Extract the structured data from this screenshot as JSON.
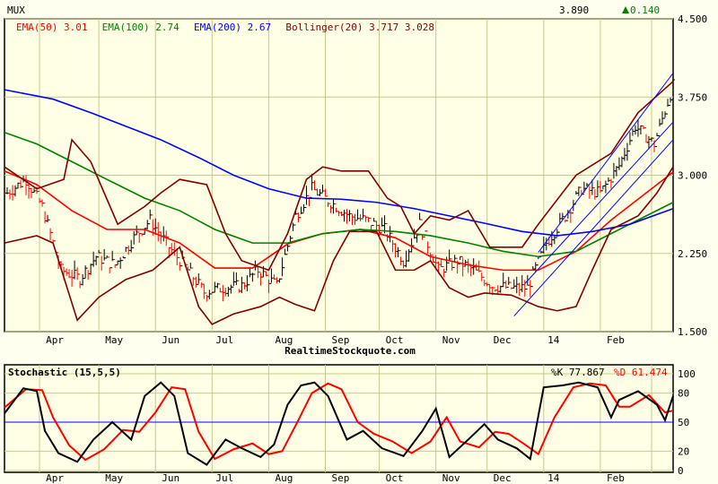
{
  "chart_data": [
    {
      "type": "line",
      "title": "MUX",
      "last_price": "3.890",
      "change": "0.140",
      "watermark": "RealtimeStockquote.com",
      "ylim": [
        1.5,
        4.5
      ],
      "yticks": [
        "4.500",
        "3.750",
        "3.000",
        "2.250",
        "1.500"
      ],
      "xlim": [
        0,
        248
      ],
      "xticks": [
        {
          "label": "Apr",
          "x": 16
        },
        {
          "label": "May",
          "x": 38
        },
        {
          "label": "Jun",
          "x": 59
        },
        {
          "label": "Jul",
          "x": 79
        },
        {
          "label": "Aug",
          "x": 101
        },
        {
          "label": "Sep",
          "x": 122
        },
        {
          "label": "Oct",
          "x": 142
        },
        {
          "label": "Nov",
          "x": 163
        },
        {
          "label": "Dec",
          "x": 182
        },
        {
          "label": "14",
          "x": 201
        },
        {
          "label": "Feb",
          "x": 224
        }
      ],
      "gridlines_x": [
        13,
        35,
        56,
        77,
        98,
        119,
        139,
        160,
        179,
        200,
        221,
        240
      ],
      "legend": [
        {
          "label": "EMA(50) 3.01",
          "color": "#ff0000"
        },
        {
          "label": "EMA(100) 2.74",
          "color": "#008000"
        },
        {
          "label": "EMA(200) 2.67",
          "color": "#0000ff"
        },
        {
          "label": "Bollinger(20) 3.717 3.028",
          "color": "#800000"
        }
      ],
      "price": {
        "x": [
          1,
          8,
          14,
          21,
          28,
          34,
          41,
          48,
          54,
          61,
          68,
          74,
          81,
          88,
          94,
          101,
          108,
          114,
          121,
          128,
          134,
          141,
          148,
          154,
          161,
          168,
          174,
          181,
          188,
          194,
          201,
          208,
          214,
          221,
          228,
          234,
          241,
          248
        ],
        "y": [
          2.83,
          2.96,
          2.7,
          2.09,
          2.01,
          2.22,
          2.14,
          2.4,
          2.57,
          2.31,
          2.09,
          1.88,
          1.92,
          1.94,
          2.09,
          1.94,
          2.61,
          2.87,
          2.74,
          2.61,
          2.57,
          2.48,
          2.18,
          2.53,
          2.09,
          2.18,
          2.09,
          1.94,
          1.92,
          1.92,
          2.35,
          2.61,
          2.87,
          2.83,
          3.09,
          3.47,
          3.3,
          3.86
        ]
      },
      "series": [
        {
          "name": "EMA(50)",
          "color": "#ff0000",
          "x": [
            0,
            12,
            25,
            38,
            52,
            65,
            78,
            92,
            105,
            118,
            132,
            145,
            158,
            172,
            185,
            198,
            212,
            225,
            238,
            248
          ],
          "y": [
            3.04,
            2.91,
            2.66,
            2.48,
            2.48,
            2.35,
            2.11,
            2.11,
            2.34,
            2.44,
            2.48,
            2.4,
            2.22,
            2.14,
            2.09,
            2.09,
            2.27,
            2.57,
            2.83,
            3.03
          ]
        },
        {
          "name": "EMA(100)",
          "color": "#008000",
          "x": [
            0,
            12,
            25,
            38,
            52,
            65,
            78,
            92,
            105,
            118,
            132,
            145,
            158,
            172,
            185,
            198,
            212,
            225,
            238,
            248
          ],
          "y": [
            3.41,
            3.3,
            3.13,
            2.96,
            2.78,
            2.66,
            2.48,
            2.35,
            2.35,
            2.44,
            2.48,
            2.46,
            2.42,
            2.35,
            2.27,
            2.22,
            2.27,
            2.44,
            2.61,
            2.74
          ]
        },
        {
          "name": "EMA(200)",
          "color": "#0000ff",
          "x": [
            0,
            18,
            32,
            45,
            58,
            72,
            85,
            98,
            112,
            125,
            138,
            152,
            165,
            178,
            192,
            205,
            218,
            232,
            248
          ],
          "y": [
            3.82,
            3.73,
            3.6,
            3.47,
            3.34,
            3.17,
            3.0,
            2.87,
            2.78,
            2.77,
            2.74,
            2.68,
            2.61,
            2.54,
            2.46,
            2.42,
            2.46,
            2.53,
            2.68
          ]
        },
        {
          "name": "Bollinger upper",
          "color": "#800000",
          "x": [
            0,
            12,
            22,
            25,
            32,
            42,
            52,
            58,
            65,
            75,
            82,
            88,
            98,
            105,
            112,
            118,
            125,
            135,
            142,
            147,
            152,
            158,
            165,
            172,
            180,
            192,
            198,
            212,
            225,
            235,
            248
          ],
          "y": [
            3.08,
            2.87,
            2.96,
            3.34,
            3.13,
            2.53,
            2.7,
            2.83,
            2.96,
            2.91,
            2.44,
            2.18,
            2.09,
            2.44,
            2.96,
            3.08,
            3.04,
            3.04,
            2.78,
            2.7,
            2.44,
            2.61,
            2.57,
            2.66,
            2.31,
            2.31,
            2.53,
            3.0,
            3.21,
            3.6,
            3.9
          ]
        },
        {
          "name": "Bollinger lower",
          "color": "#800000",
          "x": [
            0,
            12,
            18,
            27,
            35,
            45,
            55,
            65,
            72,
            77,
            85,
            95,
            102,
            108,
            115,
            122,
            128,
            138,
            145,
            152,
            158,
            165,
            172,
            178,
            188,
            198,
            205,
            212,
            218,
            225,
            235,
            242,
            248
          ],
          "y": [
            2.35,
            2.42,
            2.35,
            1.61,
            1.83,
            2.0,
            2.09,
            2.31,
            1.74,
            1.57,
            1.67,
            1.74,
            1.83,
            1.76,
            1.7,
            2.18,
            2.46,
            2.46,
            2.09,
            2.09,
            2.18,
            1.92,
            1.83,
            1.87,
            1.85,
            1.74,
            1.7,
            1.74,
            2.09,
            2.48,
            2.61,
            2.83,
            3.08
          ]
        },
        {
          "name": "Channel upper",
          "color": "#0000ff",
          "x": [
            198,
            248
          ],
          "y": [
            2.26,
            3.98
          ]
        },
        {
          "name": "Channel mid",
          "color": "#0000ff",
          "x": [
            193,
            248
          ],
          "y": [
            1.96,
            3.51
          ]
        },
        {
          "name": "Channel lower",
          "color": "#0000ff",
          "x": [
            189,
            248
          ],
          "y": [
            1.65,
            3.34
          ]
        }
      ]
    },
    {
      "type": "line",
      "title": "Stochastic (15,5,5)",
      "k_label": "%K 77.867",
      "d_label": "%D 61.474",
      "ylim": [
        0,
        100
      ],
      "yticks": [
        "100",
        "80",
        "50",
        "20",
        "0"
      ],
      "reference_line": 50,
      "series": [
        {
          "name": "%K",
          "color": "#000000",
          "x": [
            0,
            7,
            12,
            15,
            20,
            27,
            33,
            40,
            47,
            52,
            58,
            63,
            68,
            75,
            82,
            88,
            95,
            100,
            105,
            110,
            115,
            120,
            127,
            133,
            140,
            148,
            155,
            160,
            165,
            172,
            178,
            183,
            190,
            195,
            200,
            207,
            213,
            220,
            225,
            228,
            235,
            242,
            245,
            248
          ],
          "y": [
            59,
            85,
            82,
            41,
            18,
            9,
            32,
            50,
            32,
            77,
            91,
            77,
            18,
            6,
            32,
            23,
            14,
            27,
            68,
            88,
            91,
            77,
            32,
            41,
            23,
            15,
            41,
            64,
            14,
            32,
            48,
            32,
            23,
            12,
            86,
            88,
            91,
            86,
            55,
            73,
            82,
            68,
            52,
            77
          ]
        },
        {
          "name": "%D",
          "color": "#ff0000",
          "x": [
            0,
            8,
            14,
            18,
            24,
            30,
            37,
            44,
            50,
            56,
            62,
            67,
            72,
            78,
            85,
            92,
            98,
            103,
            109,
            114,
            120,
            125,
            131,
            137,
            144,
            151,
            158,
            164,
            169,
            176,
            182,
            187,
            193,
            198,
            204,
            211,
            217,
            223,
            228,
            232,
            239,
            245,
            248
          ],
          "y": [
            65,
            84,
            83,
            55,
            26,
            11,
            22,
            42,
            40,
            60,
            86,
            84,
            40,
            12,
            22,
            28,
            17,
            20,
            52,
            80,
            90,
            84,
            50,
            38,
            30,
            18,
            30,
            55,
            30,
            24,
            40,
            38,
            27,
            17,
            55,
            86,
            90,
            88,
            66,
            66,
            78,
            60,
            62
          ]
        }
      ]
    }
  ]
}
